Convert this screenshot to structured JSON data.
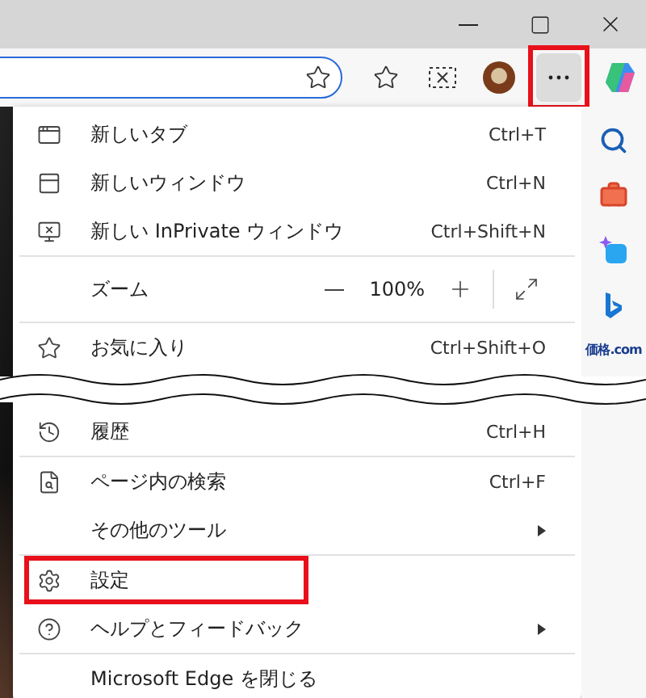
{
  "window": {
    "controls": [
      {
        "kind": "minimize"
      },
      {
        "kind": "maximize"
      },
      {
        "kind": "close"
      }
    ]
  },
  "toolbar": {
    "more_button": {
      "highlighted": true
    }
  },
  "sidebar": {
    "items": [
      {
        "kind": "search"
      },
      {
        "kind": "toolbox"
      },
      {
        "kind": "sparkle"
      },
      {
        "kind": "bing"
      },
      {
        "kind": "logo",
        "text": "価格.com"
      }
    ]
  },
  "menu": {
    "items": [
      {
        "kind": "item",
        "label": "新しいタブ",
        "shortcut": "Ctrl+T"
      },
      {
        "kind": "item",
        "label": "新しいウィンドウ",
        "shortcut": "Ctrl+N"
      },
      {
        "kind": "item",
        "label": "新しい InPrivate ウィンドウ",
        "shortcut": "Ctrl+Shift+N"
      },
      {
        "kind": "divider"
      },
      {
        "kind": "zoom",
        "label": "ズーム",
        "value": "100%"
      },
      {
        "kind": "divider"
      },
      {
        "kind": "item",
        "label": "お気に入り",
        "shortcut": "Ctrl+Shift+O"
      },
      {
        "kind": "break"
      },
      {
        "kind": "item",
        "label": "履歴",
        "shortcut": "Ctrl+H"
      },
      {
        "kind": "divider"
      },
      {
        "kind": "item",
        "label": "ページ内の検索",
        "shortcut": "Ctrl+F"
      },
      {
        "kind": "submenu",
        "label": "その他のツール"
      },
      {
        "kind": "divider"
      },
      {
        "kind": "item",
        "label": "設定",
        "highlighted": true
      },
      {
        "kind": "submenu",
        "label": "ヘルプとフィードバック"
      },
      {
        "kind": "divider"
      },
      {
        "kind": "item",
        "label": "Microsoft Edge を閉じる"
      }
    ]
  }
}
